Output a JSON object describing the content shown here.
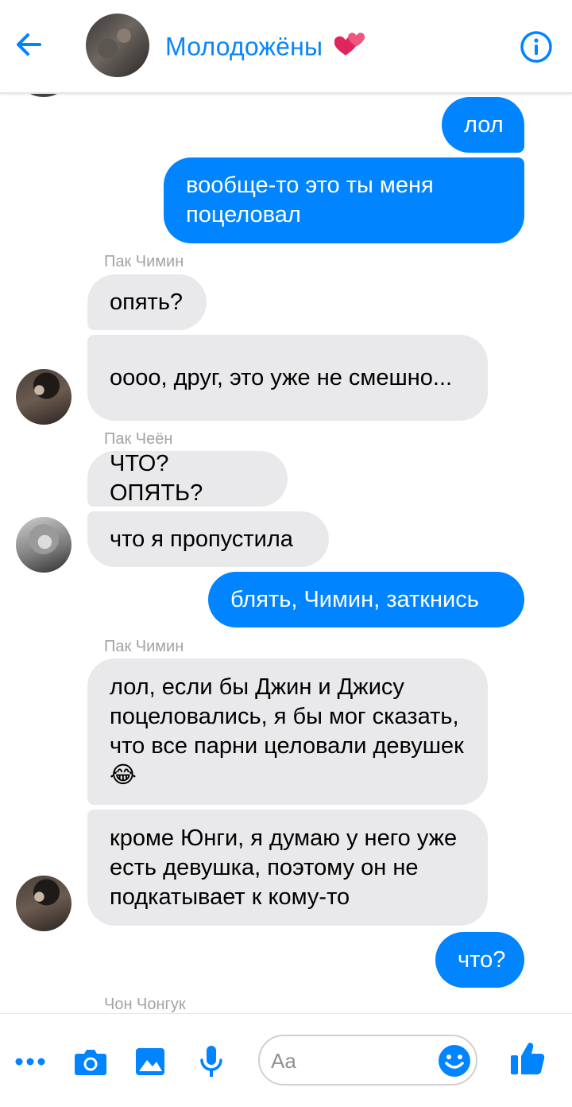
{
  "header": {
    "title": "Молодожёны",
    "title_icon": "two-hearts-icon",
    "back_icon": "arrow-left-icon",
    "info_icon": "info-icon"
  },
  "colors": {
    "accent": "#0084ff",
    "incoming_bubble": "#e9e9eb",
    "sender_text": "#a3a3a3"
  },
  "messages": [
    {
      "from": "me",
      "text": "лол"
    },
    {
      "from": "me",
      "text": "вообще-то это ты меня поцеловал"
    },
    {
      "sender": "Пак Чимин",
      "text": "опять?"
    },
    {
      "sender": "Пак Чимин",
      "text": "оооо, друг, это уже не смешно..."
    },
    {
      "sender": "Пак Чеён",
      "text": "ЧТО? ОПЯТЬ?"
    },
    {
      "sender": "Пак Чеён",
      "text": "что я пропустила"
    },
    {
      "from": "me",
      "text": "блять, Чимин, заткнись"
    },
    {
      "sender": "Пак Чимин",
      "text": "лол, если бы Джин и Джису поцеловались, я бы мог сказать, что все парни целовали девушек 😂"
    },
    {
      "sender": "Пак Чимин",
      "text": "кроме Юнги, я думаю у него уже есть девушка, поэтому он не подкатывает к кому-то"
    },
    {
      "from": "me",
      "text": "что?"
    }
  ],
  "senders": {
    "jimin_1": "Пак Чимин",
    "chaeyoung": "Пак Чеён",
    "jimin_2": "Пак Чимин",
    "jungkook": "Чон Чонгук"
  },
  "composer": {
    "placeholder": "Aa",
    "icons": [
      "more-icon",
      "camera-icon",
      "image-icon",
      "microphone-icon",
      "emoji-icon",
      "thumbs-up-icon"
    ]
  }
}
